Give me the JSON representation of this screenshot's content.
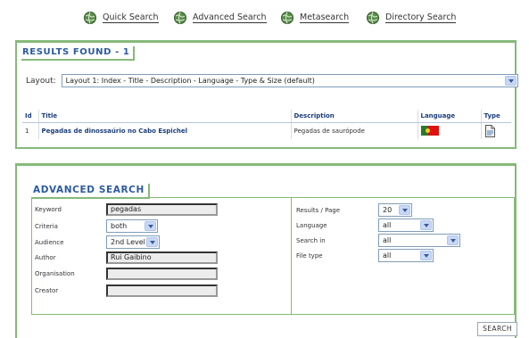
{
  "nav": {
    "items": [
      {
        "label": "Quick Search",
        "icon": "globe-icon"
      },
      {
        "label": "Advanced Search",
        "icon": "globe-icon"
      },
      {
        "label": "Metasearch",
        "icon": "globe-icon"
      },
      {
        "label": "Directory Search",
        "icon": "globe-icon"
      }
    ]
  },
  "results": {
    "title": "RESULTS FOUND - 1",
    "layout_label": "Layout:",
    "layout_value": "Layout 1: Index - Title - Description - Language - Type & Size (default)",
    "columns": [
      "Id",
      "Title",
      "Description",
      "Language",
      "Type"
    ],
    "rows": [
      {
        "id": "1",
        "title": "Pegadas de dinossaúrio no Cabo Espichel",
        "description": "Pegadas de saurópode",
        "language_icon": "portugal-flag-icon",
        "type_icon": "document-icon"
      }
    ]
  },
  "advanced": {
    "title": "ADVANCED SEARCH",
    "keyword_label": "Keyword",
    "keyword_value": "pegadas",
    "criteria_label": "Criteria",
    "criteria_value": "both",
    "audience_label": "Audience",
    "audience_value": "2nd Level",
    "author_label": "Author",
    "author_value": "Rui Gaibino",
    "organisation_label": "Organisation",
    "organisation_value": "",
    "creator_label": "Creator",
    "creator_value": "",
    "results_page_label": "Results / Page",
    "results_page_value": "20",
    "language_label": "Language",
    "language_value": "all",
    "search_in_label": "Search in",
    "search_in_value": "all",
    "file_type_label": "File type",
    "file_type_value": "all",
    "search_button": "SEARCH"
  },
  "colors": {
    "accent_green": "#86b97a",
    "title_blue": "#2b5aa0",
    "link_dark": "#333333"
  }
}
